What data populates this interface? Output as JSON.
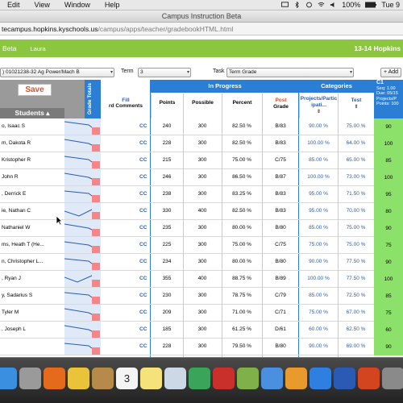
{
  "menubar": {
    "items": [
      "Edit",
      "View",
      "Window",
      "Help"
    ],
    "battery": "100%",
    "clock": "Tue 9"
  },
  "browser": {
    "window_title": "Campus Instruction Beta",
    "url_host": "tecampus.hopkins.kyschools.us",
    "url_path": "/campus/apps/teacher/gradebookHTML.html"
  },
  "campus_header": {
    "product": "Beta",
    "user": "Laura",
    "year": "13-14 Hopkins"
  },
  "filters": {
    "section_value": ") 01021238-32 Ag Power/Mach B",
    "term_label": "Term",
    "term_value": "3",
    "task_label": "Task",
    "task_value": "Term Grade",
    "add_label": "+ Add"
  },
  "grid_header": {
    "save_label": "Save",
    "students_label": "Students",
    "grade_totals_label": "Grade Totals",
    "fill_label": "Fill",
    "comments_label": "rd Comments",
    "in_progress_label": "In Progress",
    "categories_label": "Categories",
    "columns": {
      "points": "Points",
      "possible": "Possible",
      "percent": "Percent",
      "post": "Post",
      "grade": "Grade",
      "projects": "Projects/Partic ipati...",
      "test": "Test"
    },
    "assignment": {
      "code": "C1",
      "seq": "Seq: 1.00",
      "due": "Due: 05/15",
      "category": "Projects/P",
      "points": "Points: 100"
    }
  },
  "students": [
    {
      "name": "o, Isaac S",
      "cc": "CC",
      "points": "240",
      "possible": "300",
      "percent": "82.50 %",
      "grade": "B/83",
      "projects": "90.00 %",
      "test": "75.00 %",
      "score": "90"
    },
    {
      "name": "m, Dakota R",
      "cc": "CC",
      "points": "228",
      "possible": "300",
      "percent": "82.50 %",
      "grade": "B/83",
      "projects": "100.00 %",
      "test": "64.00 %",
      "score": "100"
    },
    {
      "name": "Kristopher R",
      "cc": "CC",
      "points": "215",
      "possible": "300",
      "percent": "75.00 %",
      "grade": "C/75",
      "projects": "85.00 %",
      "test": "65.00 %",
      "score": "85"
    },
    {
      "name": "John R",
      "cc": "CC",
      "points": "246",
      "possible": "300",
      "percent": "86.50 %",
      "grade": "B/87",
      "projects": "100.00 %",
      "test": "73.00 %",
      "score": "100"
    },
    {
      "name": ", Derrick E",
      "cc": "CC",
      "points": "238",
      "possible": "300",
      "percent": "83.25 %",
      "grade": "B/83",
      "projects": "95.00 %",
      "test": "71.50 %",
      "score": "95"
    },
    {
      "name": "ie, Nathan C",
      "cc": "CC",
      "points": "330",
      "possible": "400",
      "percent": "82.50 %",
      "grade": "B/83",
      "projects": "95.00 %",
      "test": "70.00 %",
      "score": "80"
    },
    {
      "name": "Nathaniel W",
      "cc": "CC",
      "points": "235",
      "possible": "300",
      "percent": "80.00 %",
      "grade": "B/80",
      "projects": "85.00 %",
      "test": "75.00 %",
      "score": "90"
    },
    {
      "name": "ms, Heath T (He...",
      "cc": "CC",
      "points": "225",
      "possible": "300",
      "percent": "75.00 %",
      "grade": "C/75",
      "projects": "75.00 %",
      "test": "75.00 %",
      "score": "75"
    },
    {
      "name": "n, Christopher L...",
      "cc": "CC",
      "points": "234",
      "possible": "300",
      "percent": "80.00 %",
      "grade": "B/80",
      "projects": "90.00 %",
      "test": "77.50 %",
      "score": "90"
    },
    {
      "name": ", Ryan J",
      "cc": "CC",
      "points": "355",
      "possible": "400",
      "percent": "88.75 %",
      "grade": "B/89",
      "projects": "100.00 %",
      "test": "77.50 %",
      "score": "100"
    },
    {
      "name": "y, Sadarius S",
      "cc": "CC",
      "points": "230",
      "possible": "300",
      "percent": "78.75 %",
      "grade": "C/79",
      "projects": "85.00 %",
      "test": "72.50 %",
      "score": "85"
    },
    {
      "name": "Tyler M",
      "cc": "CC",
      "points": "209",
      "possible": "300",
      "percent": "71.00 %",
      "grade": "C/71",
      "projects": "75.00 %",
      "test": "67.00 %",
      "score": "75"
    },
    {
      "name": ", Joseph L",
      "cc": "CC",
      "points": "185",
      "possible": "300",
      "percent": "61.25 %",
      "grade": "D/61",
      "projects": "60.00 %",
      "test": "62.50 %",
      "score": "60"
    },
    {
      "name": "",
      "cc": "CC",
      "points": "228",
      "possible": "300",
      "percent": "79.50 %",
      "grade": "B/80",
      "projects": "90.00 %",
      "test": "69.00 %",
      "score": "90"
    }
  ],
  "dock": {
    "calendar_day": "3",
    "apps": [
      "finder-icon",
      "launchpad-icon",
      "firefox-icon",
      "chrome-icon",
      "contacts-icon",
      "calendar-icon",
      "notes-icon",
      "preview-icon",
      "facetime-icon",
      "photobooth-icon",
      "photo-icon",
      "itunes-icon",
      "ibooks-icon",
      "appstore-icon",
      "word-icon",
      "powerpoint-icon",
      "system-prefs-icon"
    ]
  }
}
